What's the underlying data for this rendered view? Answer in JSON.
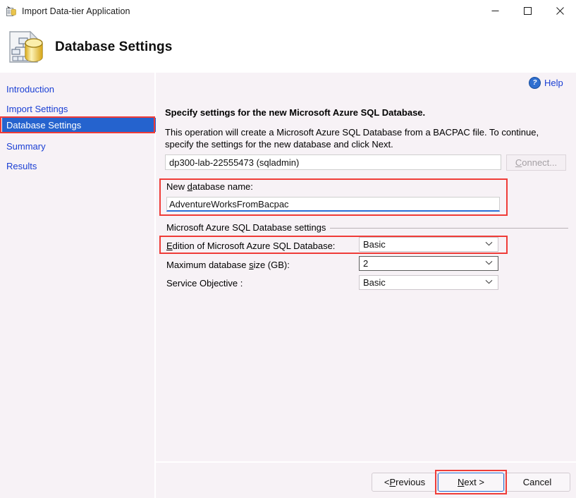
{
  "window": {
    "title": "Import Data-tier Application",
    "app_icon": "import-data-tier-icon",
    "minimize_label": "—",
    "maximize_label": "☐",
    "close_label": "✕"
  },
  "header": {
    "title": "Database Settings",
    "icon": "database-document-icon"
  },
  "sidebar": {
    "items": [
      {
        "label": "Introduction",
        "selected": false
      },
      {
        "label": "Import Settings",
        "selected": false
      },
      {
        "label": "Database Settings",
        "selected": true
      },
      {
        "label": "Summary",
        "selected": false
      },
      {
        "label": "Results",
        "selected": false
      }
    ]
  },
  "help": {
    "label": "Help",
    "icon_glyph": "?"
  },
  "main": {
    "instruction_title": "Specify settings for the new Microsoft Azure SQL Database.",
    "instruction_body": "This operation will create a Microsoft Azure SQL Database from a BACPAC file. To continue, specify the settings for the new database and click Next.",
    "server": {
      "value": "dp300-lab-22555473 (sqladmin)",
      "placeholder": "",
      "connect_button": "Connect...",
      "connect_prefix": "C",
      "connect_rest": "onnect..."
    },
    "new_database": {
      "label_prefix": "New ",
      "label_accesskey": "d",
      "label_suffix": "atabase name:",
      "value": "AdventureWorksFromBacpac",
      "placeholder": ""
    },
    "group": {
      "label": "Microsoft Azure SQL Database settings",
      "rows": [
        {
          "label_prefix": "",
          "label_accesskey": "E",
          "label_suffix": "dition of Microsoft Azure SQL Database:",
          "value": "Basic",
          "emphasized": false
        },
        {
          "label_prefix": "Maximum database ",
          "label_accesskey": "s",
          "label_suffix": "ize (GB):",
          "value": "2",
          "emphasized": true
        },
        {
          "label_prefix": "Service Objective :",
          "label_accesskey": "",
          "label_suffix": "",
          "value": "Basic",
          "emphasized": false
        }
      ]
    }
  },
  "footer": {
    "previous": {
      "prefix": "< ",
      "accesskey": "P",
      "suffix": "revious"
    },
    "next": {
      "prefix": "",
      "accesskey": "N",
      "suffix": "ext >"
    },
    "cancel": {
      "prefix": "Cancel",
      "accesskey": "",
      "suffix": ""
    }
  },
  "colors": {
    "accent_blue": "#2563ce",
    "link_blue": "#1a3fd4",
    "annotation_red": "#ef3c38",
    "panel_bg": "#f7f2f6",
    "focus_blue": "#2a6fd6"
  }
}
